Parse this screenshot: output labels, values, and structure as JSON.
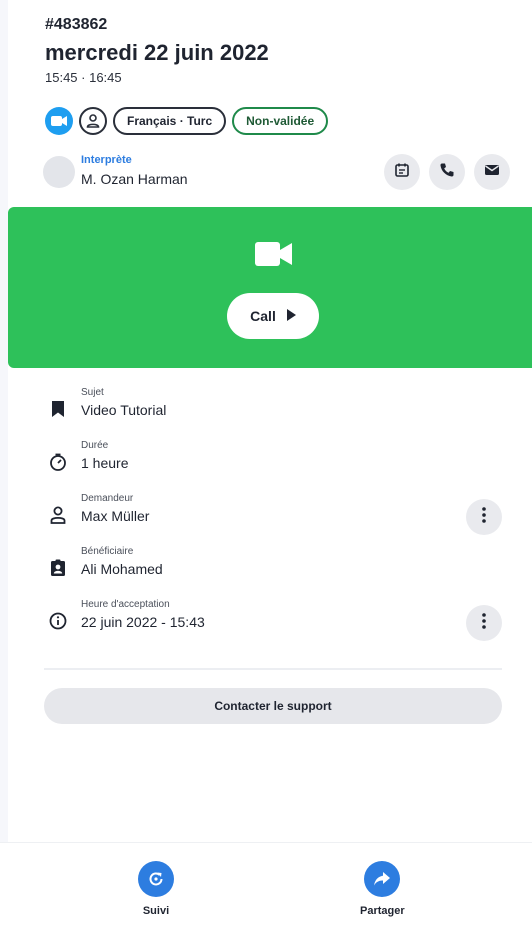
{
  "header": {
    "order_id": "#483862",
    "date": "mercredi 22 juin 2022",
    "time_range": "15:45 · 16:45"
  },
  "tags": {
    "video_icon": "video-camera-icon",
    "person_icon": "person-icon",
    "languages": "Français · Turc",
    "status": "Non-validée"
  },
  "interpreter": {
    "label": "Interprète",
    "name": "M. Ozan Harman",
    "actions": [
      "calendar-icon",
      "phone-icon",
      "mail-icon"
    ]
  },
  "call": {
    "label": "Call",
    "icon": "video-camera-icon",
    "accent": "#2ec15a"
  },
  "details": [
    {
      "label": "Sujet",
      "value": "Video Tutorial",
      "icon": "bookmark-icon"
    },
    {
      "label": "Durée",
      "value": "1 heure",
      "icon": "timer-icon"
    },
    {
      "label": "Demandeur",
      "value": "Max Müller",
      "icon": "person-outline-icon"
    },
    {
      "label": "Bénéficiaire",
      "value": "Ali Mohamed",
      "icon": "badge-icon"
    },
    {
      "label": "Heure d'acceptation",
      "value": "22 juin 2022 - 15:43",
      "icon": "info-icon"
    }
  ],
  "support": {
    "label": "Contacter le support"
  },
  "bottom_nav": [
    {
      "label": "Suivi",
      "icon": "refresh-icon"
    },
    {
      "label": "Partager",
      "icon": "share-icon"
    }
  ],
  "colors": {
    "primary": "#2d7de0",
    "video_tag": "#1e9ef0",
    "status_border": "#1f8a4a"
  }
}
